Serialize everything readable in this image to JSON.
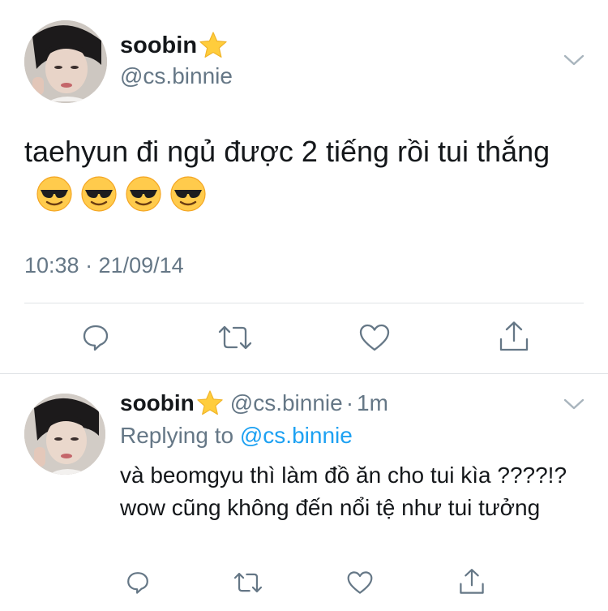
{
  "main_tweet": {
    "display_name": "soobin",
    "name_emoji": "star-emoji",
    "handle": "@cs.binnie",
    "text": "taehyun đi ngủ được 2 tiếng rồi tui thắng",
    "trailing_emojis": [
      "sunglasses-emoji",
      "sunglasses-emoji",
      "sunglasses-emoji",
      "sunglasses-emoji"
    ],
    "timestamp": "10:38 · 21/09/14",
    "actions": [
      "reply-icon",
      "retweet-icon",
      "like-icon",
      "share-icon"
    ]
  },
  "reply_tweet": {
    "display_name": "soobin",
    "handle": "@cs.binnie",
    "separator": "·",
    "time_ago": "1m",
    "replying_prefix": "Replying to",
    "replying_to": "@cs.binnie",
    "text": "và beomgyu thì làm đồ ăn cho tui kìa ????!? wow cũng không đến nổi tệ như tui tưởng",
    "actions": [
      "reply-icon",
      "retweet-icon",
      "like-icon",
      "share-icon"
    ]
  },
  "colors": {
    "text": "#14171a",
    "secondary": "#657786",
    "link": "#1da1f2",
    "divider": "#dfe3e6"
  }
}
